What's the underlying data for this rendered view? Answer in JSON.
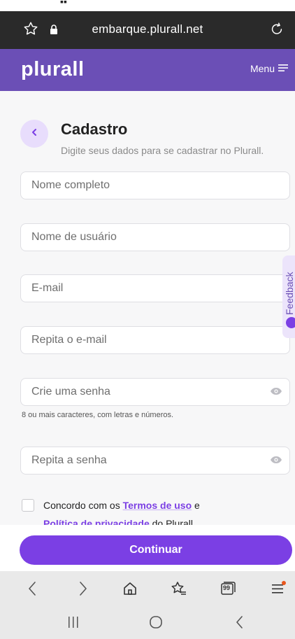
{
  "browser": {
    "url": "embarque.plurall.net"
  },
  "header": {
    "logo": "plurall",
    "menu_label": "Menu"
  },
  "page": {
    "title": "Cadastro",
    "subtitle": "Digite seus dados para se cadastrar no Plurall."
  },
  "form": {
    "full_name": {
      "placeholder": "Nome completo",
      "value": ""
    },
    "username": {
      "placeholder": "Nome de usuário",
      "value": ""
    },
    "email": {
      "placeholder": "E-mail",
      "value": ""
    },
    "email_repeat": {
      "placeholder": "Repita o e-mail",
      "value": ""
    },
    "password": {
      "placeholder": "Crie uma senha",
      "value": ""
    },
    "password_hint": "8 ou mais caracteres, com letras e números.",
    "password_repeat": {
      "placeholder": "Repita a senha",
      "value": ""
    }
  },
  "terms": {
    "prefix": "Concordo com os ",
    "terms_link": "Termos de uso",
    "middle": " e",
    "privacy_link": "Política de privacidade",
    "suffix": " do Plurall.",
    "checked": false
  },
  "feedback": {
    "label": "Feedback"
  },
  "actions": {
    "continue_label": "Continuar"
  },
  "colors": {
    "brand": "#6b4fb6",
    "accent": "#7b3fe4",
    "browser_bar": "#2a2a2a"
  },
  "icons": {
    "browser_bar": [
      "star-icon",
      "lock-icon",
      "reload-icon"
    ],
    "browser_nav": [
      "back-arrow-icon",
      "forward-arrow-icon",
      "home-icon",
      "bookmarks-icon",
      "tabs-icon",
      "menu-icon"
    ],
    "system_nav": [
      "recents-icon",
      "home-circle-icon",
      "back-icon"
    ]
  },
  "browser_nav": {
    "tabs_count": "99"
  }
}
